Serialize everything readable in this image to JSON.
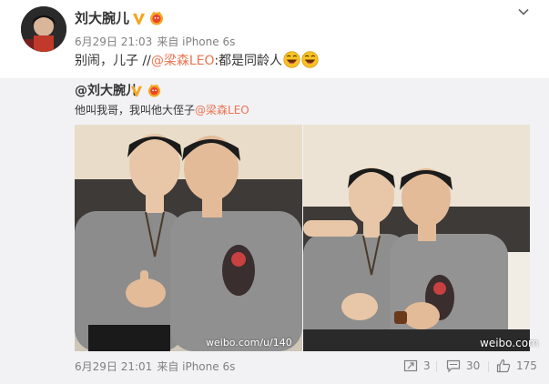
{
  "post": {
    "author_name": "刘大腕儿",
    "time": "6月29日 21:03",
    "source": "来自 iPhone 6s",
    "text_before": "别闹，儿子 //",
    "mention": "@梁森LEO",
    "text_after": ":都是同龄人"
  },
  "original": {
    "author_name": "@刘大腕儿",
    "text_before": "他叫我哥，我叫他大侄子",
    "mention": "@梁森LEO",
    "watermark_1": "weibo.com/u/140",
    "watermark_2": "weibo.com",
    "time": "6月29日 21:01",
    "source": "来自 iPhone 6s",
    "repost_count": "3",
    "comment_count": "30",
    "like_count": "175"
  },
  "colors": {
    "link": "#eb7350",
    "badge_gold": "#f5a623",
    "repost_bg": "#f2f2f5",
    "meta_text": "#808080"
  },
  "icons": [
    "verified-icon",
    "vip-icon",
    "chevron-down-icon",
    "laugh-emoji-icon",
    "repost-icon",
    "comment-icon",
    "like-icon"
  ]
}
